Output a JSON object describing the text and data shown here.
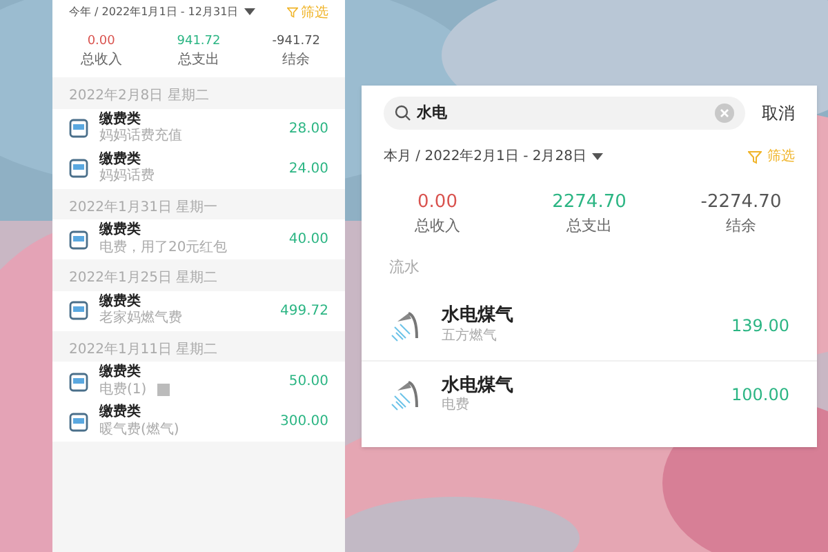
{
  "left_screen": {
    "period": "今年 / 2022年1月1日 - 12月31日",
    "filter": "筛选",
    "summary": [
      {
        "kind": "income",
        "value": "0.00",
        "label": "总收入"
      },
      {
        "kind": "expense",
        "value": "941.72",
        "label": "总支出"
      },
      {
        "kind": "balance",
        "value": "-941.72",
        "label": "结余"
      }
    ],
    "groups": [
      {
        "date": "2022年2月8日 星期二",
        "items": [
          {
            "category": "缴费类",
            "note": "妈妈话费充值",
            "amount": "28.00",
            "has_image": false
          },
          {
            "category": "缴费类",
            "note": "妈妈话费",
            "amount": "24.00",
            "has_image": false
          }
        ]
      },
      {
        "date": "2022年1月31日 星期一",
        "items": [
          {
            "category": "缴费类",
            "note": "电费，用了20元红包",
            "amount": "40.00",
            "has_image": false
          }
        ]
      },
      {
        "date": "2022年1月25日 星期二",
        "items": [
          {
            "category": "缴费类",
            "note": "老家妈燃气费",
            "amount": "499.72",
            "has_image": false
          }
        ]
      },
      {
        "date": "2022年1月11日 星期二",
        "items": [
          {
            "category": "缴费类",
            "note": "电费(1)",
            "amount": "50.00",
            "has_image": true
          },
          {
            "category": "缴费类",
            "note": "暖气费(燃气)",
            "amount": "300.00",
            "has_image": false
          }
        ]
      }
    ]
  },
  "right_screen": {
    "search": {
      "value": "水电"
    },
    "cancel": "取消",
    "period": "本月 / 2022年2月1日 - 2月28日",
    "filter": "筛选",
    "summary": [
      {
        "kind": "income",
        "value": "0.00",
        "label": "总收入"
      },
      {
        "kind": "expense",
        "value": "2274.70",
        "label": "总支出"
      },
      {
        "kind": "balance",
        "value": "-2274.70",
        "label": "结余"
      }
    ],
    "section": "流水",
    "items": [
      {
        "category": "水电煤气",
        "note": "五方燃气",
        "amount": "139.00"
      },
      {
        "category": "水电煤气",
        "note": "电费",
        "amount": "100.00"
      }
    ]
  }
}
